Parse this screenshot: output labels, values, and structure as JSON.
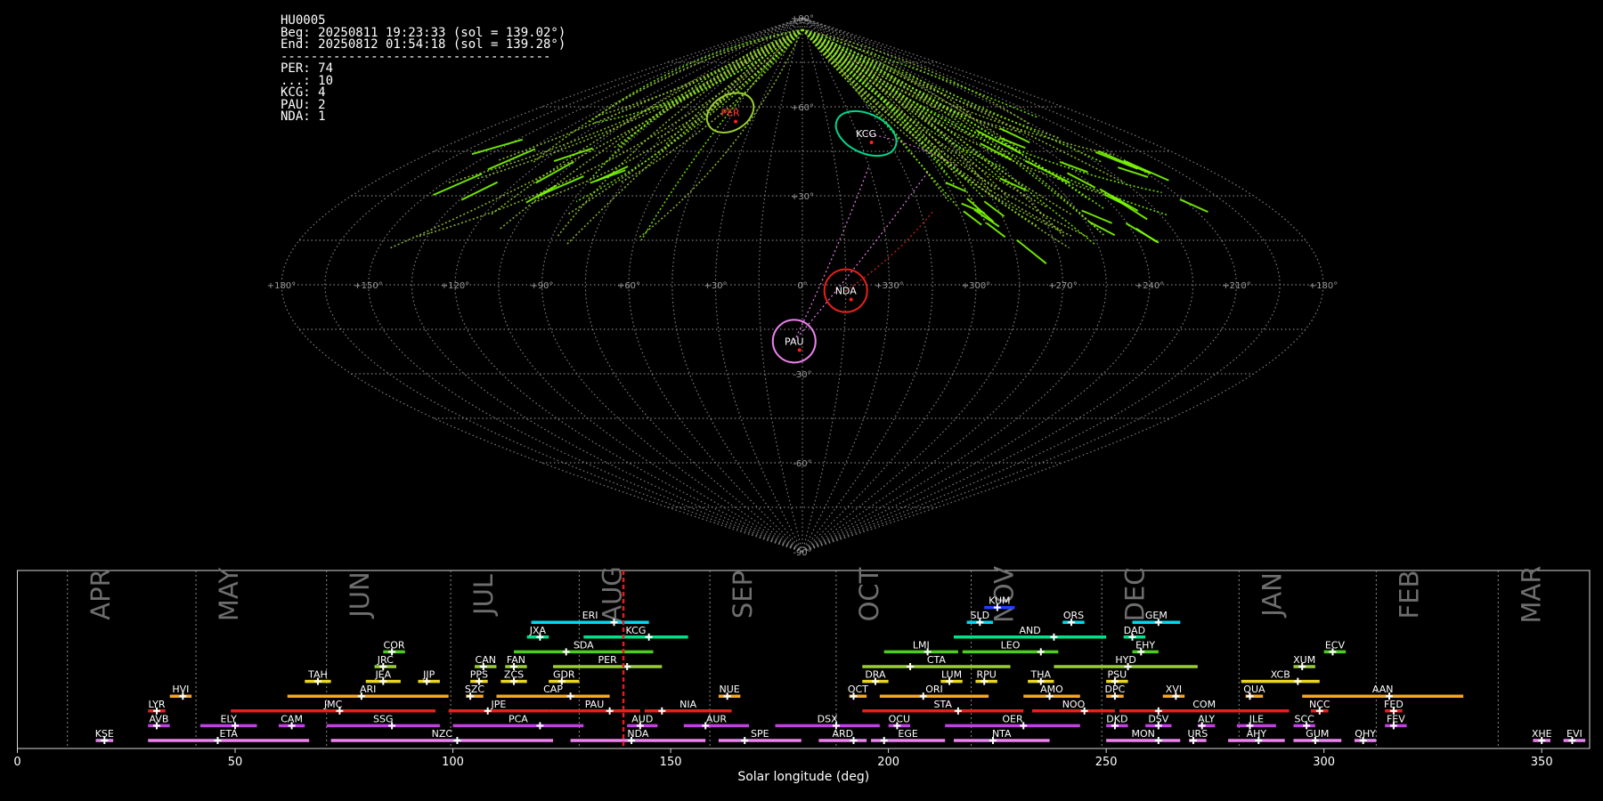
{
  "info": {
    "station": "HU0005",
    "begin": "Beg: 20250811 19:23:33 (sol = 139.02°)",
    "end": "End: 20250812 01:54:18 (sol = 139.28°)",
    "separator": "------------------------------------",
    "counts": [
      "PER: 74",
      "...: 10",
      "KCG: 4",
      "PAU: 2",
      "NDA: 1"
    ]
  },
  "colors": {
    "PER": "#9acd32",
    "KCG": "#00d68f",
    "NDA": "#e8201a",
    "PAU": "#ee82ee",
    "sporadic": "#7cfc00",
    "grid": "#8a8a8a",
    "current": "#e41a1c"
  },
  "chart_data": [
    {
      "type": "scatter",
      "projection": "sinusoidal (Sanson-Flamsteed), sun-centred ecliptic",
      "lon_ticks": [
        "+180°",
        "+150°",
        "+120°",
        "+90°",
        "+60°",
        "+30°",
        "0°",
        "+330°",
        "+300°",
        "+270°",
        "+240°",
        "+210°",
        "+180°"
      ],
      "lat_ticks": [
        "+90°",
        "+60°",
        "+30°",
        "-30°",
        "-60°",
        "-90°"
      ],
      "radiants": [
        {
          "name": "PER",
          "lon": 47,
          "lat": 58
        },
        {
          "name": "KCG",
          "lon": 325,
          "lat": 51
        },
        {
          "name": "NDA",
          "lon": 345,
          "lat": -2
        },
        {
          "name": "PAU",
          "lon": 3,
          "lat": -19
        }
      ]
    },
    {
      "type": "gantt",
      "xlabel": "Solar longitude (deg)",
      "xlim": [
        0,
        361
      ],
      "xticks": [
        0,
        50,
        100,
        150,
        200,
        250,
        300,
        350
      ],
      "current_sol": 139.15,
      "months": [
        {
          "name": "APR",
          "start": 11.5,
          "end": 41
        },
        {
          "name": "MAY",
          "start": 41,
          "end": 71
        },
        {
          "name": "JUN",
          "start": 71,
          "end": 99.5
        },
        {
          "name": "JUL",
          "start": 99.5,
          "end": 129
        },
        {
          "name": "AUG",
          "start": 129,
          "end": 159
        },
        {
          "name": "SEP",
          "start": 159,
          "end": 188
        },
        {
          "name": "OCT",
          "start": 188,
          "end": 219
        },
        {
          "name": "NOV",
          "start": 219,
          "end": 249
        },
        {
          "name": "DEC",
          "start": 249,
          "end": 280.5
        },
        {
          "name": "JAN",
          "start": 280.5,
          "end": 312
        },
        {
          "name": "FEB",
          "start": 312,
          "end": 340
        },
        {
          "name": "MAR",
          "start": 340,
          "end": 371
        }
      ],
      "showers": [
        {
          "code": "KUM",
          "start": 222,
          "end": 229,
          "peak": 225,
          "row": 10,
          "color": "#1e40ff"
        },
        {
          "code": "ERI",
          "start": 118,
          "end": 145,
          "peak": 137,
          "row": 9,
          "color": "#00d8f0"
        },
        {
          "code": "SLD",
          "start": 218,
          "end": 224,
          "peak": 221,
          "row": 9,
          "color": "#00d8f0"
        },
        {
          "code": "ORS",
          "start": 240,
          "end": 245,
          "peak": 242,
          "row": 9,
          "color": "#00d8f0"
        },
        {
          "code": "GEM",
          "start": 256,
          "end": 267,
          "peak": 262,
          "row": 9,
          "color": "#00d8f0"
        },
        {
          "code": "JXA",
          "start": 117,
          "end": 122,
          "peak": 120,
          "row": 8,
          "color": "#00e08a"
        },
        {
          "code": "KCG",
          "start": 130,
          "end": 154,
          "peak": 145,
          "row": 8,
          "color": "#00e08a"
        },
        {
          "code": "AND",
          "start": 215,
          "end": 250,
          "peak": 238,
          "row": 8,
          "color": "#00e08a"
        },
        {
          "code": "DAD",
          "start": 254,
          "end": 259,
          "peak": 256,
          "row": 8,
          "color": "#00e08a"
        },
        {
          "code": "COR",
          "start": 84,
          "end": 89,
          "peak": 86,
          "row": 7,
          "color": "#4ccf1a"
        },
        {
          "code": "SDA",
          "start": 114,
          "end": 146,
          "peak": 126,
          "row": 7,
          "color": "#4ccf1a"
        },
        {
          "code": "LMI",
          "start": 199,
          "end": 216,
          "peak": 209,
          "row": 7,
          "color": "#4ccf1a"
        },
        {
          "code": "LEO",
          "start": 217,
          "end": 239,
          "peak": 235,
          "row": 7,
          "color": "#4ccf1a"
        },
        {
          "code": "EHY",
          "start": 256,
          "end": 262,
          "peak": 258,
          "row": 7,
          "color": "#4ccf1a"
        },
        {
          "code": "ECV",
          "start": 300,
          "end": 305,
          "peak": 302,
          "row": 7,
          "color": "#4ccf1a"
        },
        {
          "code": "JRC",
          "start": 82,
          "end": 87,
          "peak": 84,
          "row": 6,
          "color": "#9acd32"
        },
        {
          "code": "CAN",
          "start": 105,
          "end": 110,
          "peak": 107,
          "row": 6,
          "color": "#9acd32"
        },
        {
          "code": "FAN",
          "start": 112,
          "end": 117,
          "peak": 114,
          "row": 6,
          "color": "#9acd32"
        },
        {
          "code": "PER",
          "start": 123,
          "end": 148,
          "peak": 140,
          "row": 6,
          "color": "#9acd32"
        },
        {
          "code": "CTA",
          "start": 194,
          "end": 228,
          "peak": 205,
          "row": 6,
          "color": "#9acd32"
        },
        {
          "code": "HYD",
          "start": 238,
          "end": 271,
          "peak": 255,
          "row": 6,
          "color": "#9acd32"
        },
        {
          "code": "XUM",
          "start": 293,
          "end": 298,
          "peak": 295,
          "row": 6,
          "color": "#9acd32"
        },
        {
          "code": "TAH",
          "start": 66,
          "end": 72,
          "peak": 69,
          "row": 5,
          "color": "#e8d520"
        },
        {
          "code": "JEA",
          "start": 80,
          "end": 88,
          "peak": 84,
          "row": 5,
          "color": "#e8d520"
        },
        {
          "code": "JIP",
          "start": 92,
          "end": 97,
          "peak": 94,
          "row": 5,
          "color": "#e8d520"
        },
        {
          "code": "PPS",
          "start": 104,
          "end": 108,
          "peak": 106,
          "row": 5,
          "color": "#e8d520"
        },
        {
          "code": "ZCS",
          "start": 111,
          "end": 117,
          "peak": 114,
          "row": 5,
          "color": "#e8d520"
        },
        {
          "code": "GDR",
          "start": 122,
          "end": 129,
          "peak": 125,
          "row": 5,
          "color": "#e8d520"
        },
        {
          "code": "DRA",
          "start": 194,
          "end": 200,
          "peak": 197,
          "row": 5,
          "color": "#e8d520"
        },
        {
          "code": "LUM",
          "start": 212,
          "end": 217,
          "peak": 214,
          "row": 5,
          "color": "#e8d520"
        },
        {
          "code": "RPU",
          "start": 220,
          "end": 225,
          "peak": 222,
          "row": 5,
          "color": "#e8d520"
        },
        {
          "code": "THA",
          "start": 232,
          "end": 238,
          "peak": 235,
          "row": 5,
          "color": "#e8d520"
        },
        {
          "code": "PSU",
          "start": 250,
          "end": 255,
          "peak": 252,
          "row": 5,
          "color": "#e8d520"
        },
        {
          "code": "XCB",
          "start": 281,
          "end": 299,
          "peak": 294,
          "row": 5,
          "color": "#e8d520"
        },
        {
          "code": "HVI",
          "start": 35,
          "end": 40,
          "peak": 38,
          "row": 4,
          "color": "#f5a623"
        },
        {
          "code": "ARI",
          "start": 62,
          "end": 99,
          "peak": 79,
          "row": 4,
          "color": "#f5a623"
        },
        {
          "code": "SZC",
          "start": 103,
          "end": 107,
          "peak": 104,
          "row": 4,
          "color": "#f5a623"
        },
        {
          "code": "CAP",
          "start": 110,
          "end": 136,
          "peak": 127,
          "row": 4,
          "color": "#f5a623"
        },
        {
          "code": "NUE",
          "start": 161,
          "end": 166,
          "peak": 163,
          "row": 4,
          "color": "#f5a623"
        },
        {
          "code": "OCT",
          "start": 191,
          "end": 195,
          "peak": 192,
          "row": 4,
          "color": "#f5a623"
        },
        {
          "code": "ORI",
          "start": 198,
          "end": 223,
          "peak": 208,
          "row": 4,
          "color": "#f5a623"
        },
        {
          "code": "AMO",
          "start": 231,
          "end": 244,
          "peak": 237,
          "row": 4,
          "color": "#f5a623"
        },
        {
          "code": "DPC",
          "start": 250,
          "end": 254,
          "peak": 252,
          "row": 4,
          "color": "#f5a623"
        },
        {
          "code": "XVI",
          "start": 263,
          "end": 268,
          "peak": 266,
          "row": 4,
          "color": "#f5a623"
        },
        {
          "code": "QUA",
          "start": 282,
          "end": 286,
          "peak": 283,
          "row": 4,
          "color": "#f5a623"
        },
        {
          "code": "AAN",
          "start": 295,
          "end": 332,
          "peak": 315,
          "row": 4,
          "color": "#f5a623"
        },
        {
          "code": "LYR",
          "start": 30,
          "end": 34,
          "peak": 32,
          "row": 3,
          "color": "#e8201a"
        },
        {
          "code": "JMC",
          "start": 49,
          "end": 96,
          "peak": 74,
          "row": 3,
          "color": "#e8201a"
        },
        {
          "code": "JPE",
          "start": 99,
          "end": 122,
          "peak": 108,
          "row": 3,
          "color": "#e8201a"
        },
        {
          "code": "PAU",
          "start": 122,
          "end": 143,
          "peak": 136,
          "row": 3,
          "color": "#e8201a"
        },
        {
          "code": "NIA",
          "start": 144,
          "end": 164,
          "peak": 148,
          "row": 3,
          "color": "#e8201a"
        },
        {
          "code": "STA",
          "start": 194,
          "end": 231,
          "peak": 216,
          "row": 3,
          "color": "#e8201a"
        },
        {
          "code": "NOO",
          "start": 233,
          "end": 252,
          "peak": 245,
          "row": 3,
          "color": "#e8201a"
        },
        {
          "code": "COM",
          "start": 253,
          "end": 292,
          "peak": 262,
          "row": 3,
          "color": "#e8201a"
        },
        {
          "code": "NCC",
          "start": 297,
          "end": 301,
          "peak": 299,
          "row": 3,
          "color": "#e8201a"
        },
        {
          "code": "FED",
          "start": 314,
          "end": 318,
          "peak": 316,
          "row": 3,
          "color": "#e8201a"
        },
        {
          "code": "AVB",
          "start": 30,
          "end": 35,
          "peak": 32,
          "row": 2,
          "color": "#c23fe0"
        },
        {
          "code": "ELY",
          "start": 42,
          "end": 55,
          "peak": 50,
          "row": 2,
          "color": "#c23fe0"
        },
        {
          "code": "CAM",
          "start": 60,
          "end": 66,
          "peak": 63,
          "row": 2,
          "color": "#c23fe0"
        },
        {
          "code": "SSG",
          "start": 71,
          "end": 97,
          "peak": 86,
          "row": 2,
          "color": "#c23fe0"
        },
        {
          "code": "PCA",
          "start": 100,
          "end": 130,
          "peak": 120,
          "row": 2,
          "color": "#c23fe0"
        },
        {
          "code": "AUD",
          "start": 140,
          "end": 147,
          "peak": 143,
          "row": 2,
          "color": "#c23fe0"
        },
        {
          "code": "AUR",
          "start": 153,
          "end": 168,
          "peak": 158,
          "row": 2,
          "color": "#c23fe0"
        },
        {
          "code": "DSX",
          "start": 174,
          "end": 198,
          "peak": 188,
          "row": 2,
          "color": "#c23fe0"
        },
        {
          "code": "OCU",
          "start": 200,
          "end": 205,
          "peak": 202,
          "row": 2,
          "color": "#c23fe0"
        },
        {
          "code": "OER",
          "start": 213,
          "end": 244,
          "peak": 231,
          "row": 2,
          "color": "#c23fe0"
        },
        {
          "code": "DKD",
          "start": 250,
          "end": 255,
          "peak": 252,
          "row": 2,
          "color": "#c23fe0"
        },
        {
          "code": "DSV",
          "start": 259,
          "end": 265,
          "peak": 262,
          "row": 2,
          "color": "#c23fe0"
        },
        {
          "code": "ALY",
          "start": 271,
          "end": 275,
          "peak": 272,
          "row": 2,
          "color": "#c23fe0"
        },
        {
          "code": "ILE",
          "start": 280,
          "end": 289,
          "peak": 283,
          "row": 2,
          "color": "#c23fe0"
        },
        {
          "code": "SCC",
          "start": 293,
          "end": 298,
          "peak": 296,
          "row": 2,
          "color": "#c23fe0"
        },
        {
          "code": "FEV",
          "start": 314,
          "end": 319,
          "peak": 316,
          "row": 2,
          "color": "#c23fe0"
        },
        {
          "code": "KSE",
          "start": 18,
          "end": 22,
          "peak": 20,
          "row": 1,
          "color": "#ee82ee"
        },
        {
          "code": "ETA",
          "start": 30,
          "end": 67,
          "peak": 46,
          "row": 1,
          "color": "#ee82ee"
        },
        {
          "code": "NZC",
          "start": 72,
          "end": 123,
          "peak": 101,
          "row": 1,
          "color": "#ee82ee"
        },
        {
          "code": "NDA",
          "start": 127,
          "end": 158,
          "peak": 141,
          "row": 1,
          "color": "#ee82ee"
        },
        {
          "code": "SPE",
          "start": 161,
          "end": 180,
          "peak": 167,
          "row": 1,
          "color": "#ee82ee"
        },
        {
          "code": "ARD",
          "start": 184,
          "end": 195,
          "peak": 192,
          "row": 1,
          "color": "#ee82ee"
        },
        {
          "code": "EGE",
          "start": 196,
          "end": 213,
          "peak": 199,
          "row": 1,
          "color": "#ee82ee"
        },
        {
          "code": "NTA",
          "start": 215,
          "end": 237,
          "peak": 224,
          "row": 1,
          "color": "#ee82ee"
        },
        {
          "code": "MON",
          "start": 250,
          "end": 267,
          "peak": 262,
          "row": 1,
          "color": "#ee82ee"
        },
        {
          "code": "URS",
          "start": 269,
          "end": 273,
          "peak": 270,
          "row": 1,
          "color": "#ee82ee"
        },
        {
          "code": "AHY",
          "start": 278,
          "end": 291,
          "peak": 285,
          "row": 1,
          "color": "#ee82ee"
        },
        {
          "code": "GUM",
          "start": 293,
          "end": 304,
          "peak": 298,
          "row": 1,
          "color": "#ee82ee"
        },
        {
          "code": "QHY",
          "start": 307,
          "end": 312,
          "peak": 309,
          "row": 1,
          "color": "#ee82ee"
        },
        {
          "code": "XHE",
          "start": 348,
          "end": 352,
          "peak": 350,
          "row": 1,
          "color": "#ee82ee"
        },
        {
          "code": "EVI",
          "start": 355,
          "end": 360,
          "peak": 357,
          "row": 1,
          "color": "#ee82ee"
        }
      ]
    }
  ]
}
